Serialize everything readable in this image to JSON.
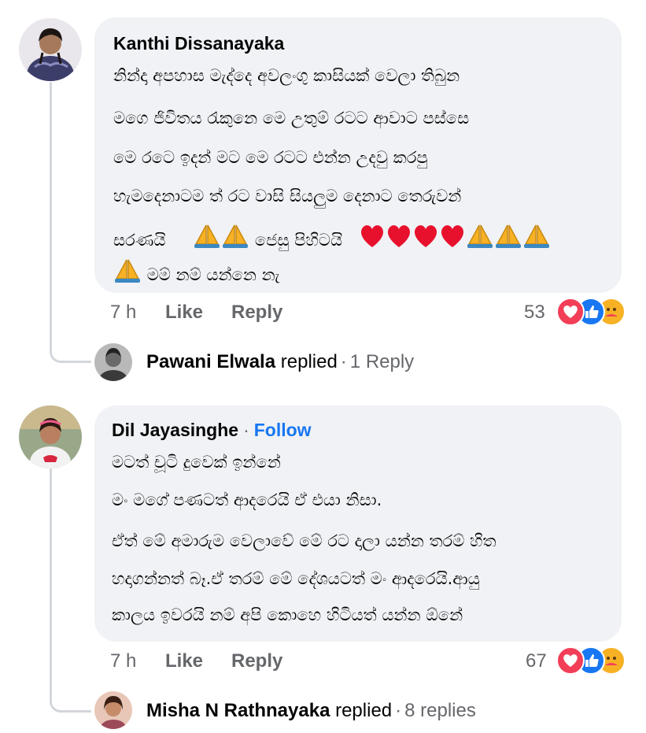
{
  "comments": [
    {
      "author": "Kanthi Dissanayaka",
      "lines": [
        "නින්දා අපහාස මැද්දෙ අවලංගු කාසියක් වෙලා තිබුන",
        "මගෙ ජිවිතය රැකුනෙ මෙ උතුම් රටට ආවාට පස්සෙ",
        "මෙ රටෙ ඉදන් මට මෙ රටට එන්න උදවු කරපු",
        "හැමදෙනාටම ත් රට වාසි සියලුම දෙනාට තෙරුවන්",
        "සරණයි",
        "ජෙසු පිහිටයි",
        "මම් නම් යන්නෙ නැ"
      ],
      "time": "7 h",
      "like_label": "Like",
      "reply_label": "Reply",
      "reaction_count": "53",
      "reply_preview": {
        "name": "Pawani Elwala",
        "replied": "replied",
        "separator": "·",
        "count": "1 Reply"
      }
    },
    {
      "author": "Dil Jayasinghe",
      "separator": "·",
      "follow": "Follow",
      "lines": [
        "මටත් චූටි දුවෙක් ඉන්නේ",
        "මං මගේ පණටත් ආදරෙයි ඒ එයා නිසා.",
        " ඒත් මේ අමාරුම වෙලාවේ මේ රට දාලා යන්න තරම් හිත",
        "හදාගන්නත් බෑ.ඒ තරම් මේ දේශයටත් මං ආදරෙයි.ආයු",
        "කාලය ඉවරයි නම් අපි කොහෙ හිටියත් යන්න ඕනේ"
      ],
      "time": "7 h",
      "like_label": "Like",
      "reply_label": "Reply",
      "reaction_count": "67",
      "reply_preview": {
        "name": "Misha N Rathnayaka",
        "replied": "replied",
        "separator": "·",
        "count": "8 replies"
      }
    }
  ],
  "colors": {
    "bubble": "#f0f2f5",
    "link": "#1877f2",
    "muted": "#65676b",
    "love": "#f33e58",
    "like": "#1877f2",
    "care": "#f7b125"
  },
  "icons": {
    "pray": "folded-hands-emoji",
    "heart": "red-heart-emoji",
    "love": "love-reaction-icon",
    "like": "like-reaction-icon",
    "care": "care-reaction-icon"
  }
}
